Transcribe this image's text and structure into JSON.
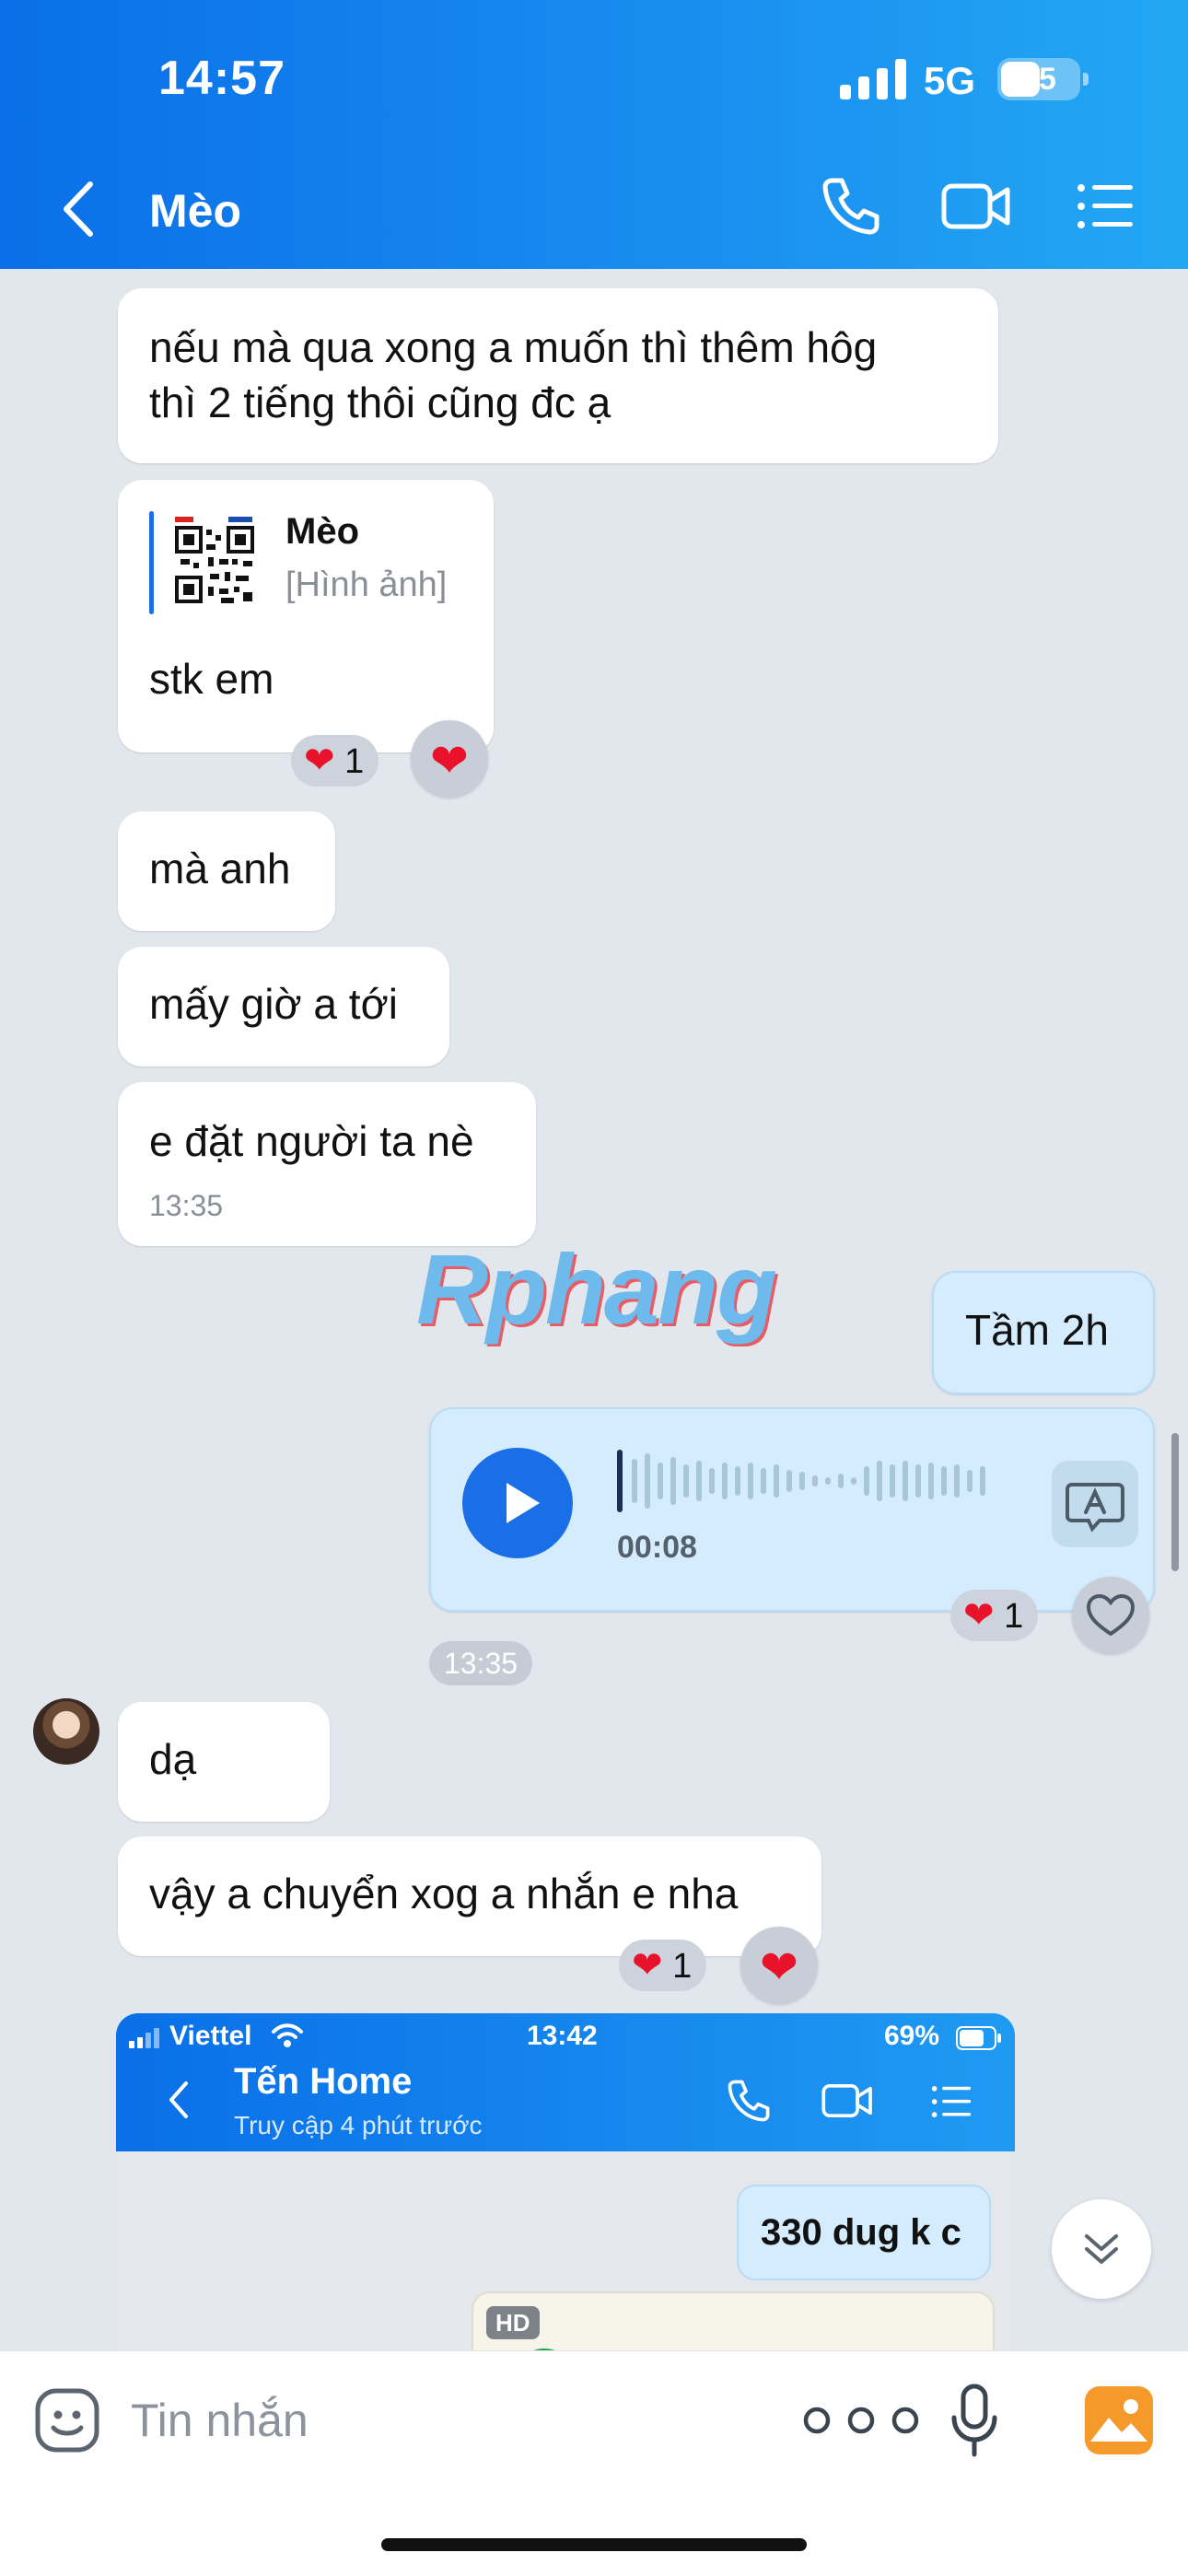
{
  "status_bar": {
    "time": "14:57",
    "network": "5G",
    "battery": "25"
  },
  "header": {
    "title": "Mèo",
    "icons": [
      "back-icon",
      "phone-icon",
      "video-call-icon",
      "menu-list-icon"
    ]
  },
  "messages": {
    "m1": {
      "line1": "nếu mà qua xong a muốn thì thêm hôg",
      "line2": "thì 2 tiếng thôi cũng đc ạ"
    },
    "m2": {
      "quote_name": "Mèo",
      "quote_type": "[Hình ảnh]",
      "text": "stk em",
      "reaction_count": "1"
    },
    "m3": {
      "text": "mà anh"
    },
    "m4": {
      "text": "mấy giờ a tới"
    },
    "m5": {
      "text": "e đặt người ta nè",
      "time": "13:35"
    },
    "m6": {
      "text": "Tầm 2h"
    },
    "m7": {
      "duration": "00:08",
      "reaction_count": "1",
      "time": "13:35"
    },
    "m8": {
      "text": "dạ"
    },
    "m9": {
      "text": "vậy a chuyển xog a nhắn e nha",
      "reaction_count": "1"
    }
  },
  "watermark": "Rphang",
  "embedded_screenshot": {
    "carrier": "Viettel",
    "time": "13:42",
    "battery": "69%",
    "title": "Tến Home",
    "subtitle": "Truy cập 4 phút trước",
    "message": "330 dug k c",
    "badge": "HD"
  },
  "composer": {
    "placeholder": "Tin nhắn"
  },
  "colors": {
    "header": "#0a6fe8",
    "accent": "#1a6fe8",
    "my_bubble": "#d4ecfd",
    "heart": "#e8122a",
    "background": "#e2e7ee"
  }
}
